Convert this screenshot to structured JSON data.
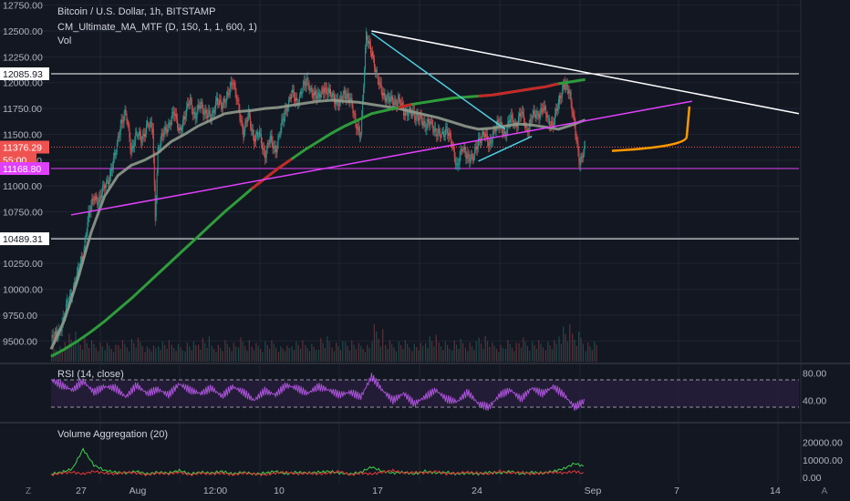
{
  "header": {
    "symbol": "Bitcoin / U.S. Dollar, 1h, BITSTAMP",
    "indicator": "CM_Ultimate_MA_MTF (D, 150, 1, 1, 600, 1)",
    "volume": "Vol"
  },
  "colors": {
    "background": "#131722",
    "up": "#26a69a",
    "down": "#ef5350",
    "trendline_white": "#ffffff",
    "trendline_magenta": "#e040fb",
    "trendline_cyan": "#4dd0e1",
    "ma_slow": "#2e9c3a",
    "ma_fast": "#8f9a8c",
    "projection": "#ff9800"
  },
  "chart_data": [
    {
      "type": "line",
      "title": "",
      "ylim": [
        9300,
        12800
      ],
      "y_ticks": [
        "12750.00",
        "12500.00",
        "12250.00",
        "12000.00",
        "11750.00",
        "11500.00",
        "11250.00",
        "11000.00",
        "10750.00",
        "10500.00",
        "10250.00",
        "10000.00",
        "9750.00",
        "9500.00"
      ],
      "x_ticks": [
        "27",
        "Aug",
        "12:00",
        "10",
        "17",
        "24",
        "Sep",
        "7",
        "14"
      ],
      "price_labels": [
        {
          "value": 12085.93,
          "text": "12085.93",
          "kind": "level"
        },
        {
          "value": 11376.29,
          "text": "11376.29",
          "kind": "last"
        },
        {
          "value": 11320,
          "text": "55:00",
          "kind": "countdown"
        },
        {
          "value": 11168.8,
          "text": "11168.80",
          "kind": "magenta"
        },
        {
          "value": 10489.31,
          "text": "10489.31",
          "kind": "level"
        }
      ],
      "horizontal_levels": [
        12085.93,
        10489.31,
        11168.8
      ],
      "last_price": 11376.29,
      "price_series": {
        "x": [
          0,
          3,
          6,
          9,
          12,
          16,
          20,
          24,
          28,
          32,
          36,
          40,
          44,
          48,
          52,
          56,
          60,
          64,
          68,
          72,
          76,
          78,
          80,
          84,
          88,
          92,
          96,
          100,
          104,
          108,
          112,
          116,
          120,
          124,
          128,
          132,
          136,
          140,
          144,
          148,
          152,
          156,
          160,
          164,
          168,
          172,
          176,
          180,
          184,
          188,
          192,
          196,
          200,
          204,
          208,
          212,
          216,
          220,
          224,
          228,
          232,
          236,
          240,
          244,
          248,
          252,
          256,
          260,
          264,
          268,
          272,
          276,
          280,
          284,
          288,
          292,
          296,
          300,
          304,
          308,
          312,
          316,
          320,
          324,
          328,
          332,
          336,
          340,
          344,
          348,
          352,
          356,
          360,
          364,
          368,
          372,
          376,
          380,
          384,
          388,
          392,
          396,
          400
        ],
        "y": [
          9500,
          9550,
          9600,
          9700,
          9850,
          10000,
          10150,
          10350,
          10700,
          10900,
          10850,
          11000,
          11100,
          11300,
          11600,
          11700,
          11350,
          11500,
          11450,
          11600,
          11550,
          10700,
          11350,
          11500,
          11600,
          11700,
          11550,
          11650,
          11850,
          11650,
          11800,
          11700,
          11650,
          11850,
          11750,
          11900,
          12000,
          11800,
          11500,
          11700,
          11450,
          11500,
          11300,
          11450,
          11350,
          11550,
          11750,
          11900,
          11800,
          11950,
          12000,
          11900,
          11850,
          11950,
          11900,
          11850,
          11800,
          11900,
          11850,
          11600,
          11500,
          12450,
          12300,
          12050,
          11900,
          11850,
          11800,
          11850,
          11700,
          11750,
          11650,
          11700,
          11550,
          11650,
          11500,
          11500,
          11550,
          11400,
          11200,
          11350,
          11300,
          11250,
          11450,
          11500,
          11400,
          11550,
          11600,
          11500,
          11650,
          11600,
          11700,
          11550,
          11650,
          11700,
          11750,
          11650,
          11600,
          11800,
          12000,
          11900,
          11600,
          11200,
          11376
        ]
      },
      "series": [
        {
          "x": [
            0,
            10,
            20,
            30,
            40,
            50,
            60,
            70,
            80,
            90,
            100,
            110,
            120,
            130,
            140,
            150,
            160,
            170,
            180,
            190,
            200,
            210,
            220,
            230,
            240,
            250,
            260,
            270,
            280,
            290,
            300,
            310,
            320,
            330,
            340,
            350,
            360,
            370,
            380,
            390,
            400
          ],
          "y": [
            9350,
            9420,
            9500,
            9590,
            9690,
            9800,
            9910,
            10030,
            10150,
            10270,
            10390,
            10510,
            10630,
            10750,
            10860,
            10970,
            11070,
            11170,
            11260,
            11350,
            11430,
            11510,
            11580,
            11640,
            11700,
            11730,
            11760,
            11790,
            11810,
            11830,
            11850,
            11860,
            11870,
            11880,
            11900,
            11920,
            11940,
            11960,
            11990,
            12010,
            12030
          ]
        },
        {
          "x": [
            0,
            10,
            20,
            30,
            40,
            50,
            60,
            70,
            80,
            90,
            100,
            110,
            120,
            130,
            140,
            150,
            160,
            170,
            180,
            190,
            200,
            210,
            220,
            230,
            240,
            250,
            260,
            270,
            280,
            290,
            300,
            310,
            320,
            330,
            340,
            350,
            360,
            370,
            380,
            390,
            400
          ],
          "y": [
            9420,
            9700,
            10100,
            10550,
            10900,
            11100,
            11200,
            11250,
            11320,
            11430,
            11500,
            11580,
            11640,
            11700,
            11720,
            11730,
            11750,
            11760,
            11780,
            11800,
            11820,
            11830,
            11820,
            11810,
            11790,
            11770,
            11750,
            11720,
            11690,
            11660,
            11620,
            11580,
            11550,
            11560,
            11580,
            11600,
            11590,
            11570,
            11550,
            11590,
            11640
          ]
        }
      ],
      "annotations": [
        {
          "kind": "trendline",
          "color": "#ffffff",
          "x": [
            240,
            560
          ],
          "y": [
            12500,
            11700
          ]
        },
        {
          "kind": "trendline",
          "color": "#e040fb",
          "x": [
            15,
            480
          ],
          "y": [
            10720,
            11820
          ]
        },
        {
          "kind": "trendline",
          "color": "#4dd0e1",
          "x": [
            240,
            340
          ],
          "y": [
            12480,
            11550
          ]
        },
        {
          "kind": "trendline",
          "color": "#4dd0e1",
          "x": [
            320,
            360
          ],
          "y": [
            11240,
            11480
          ]
        },
        {
          "kind": "projection",
          "color": "#ff9800",
          "x": [
            420,
            460,
            476,
            478
          ],
          "y": [
            11340,
            11380,
            11480,
            11770
          ]
        }
      ],
      "volume": {
        "x": [
          0,
          10,
          20,
          30,
          40,
          50,
          60,
          70,
          80,
          90,
          100,
          110,
          120,
          130,
          140,
          150,
          160,
          170,
          180,
          190,
          200,
          210,
          220,
          230,
          240,
          250,
          260,
          270,
          280,
          290,
          300,
          310,
          320,
          330,
          340,
          350,
          360,
          370,
          380,
          390,
          400
        ],
        "values": [
          0.2,
          0.5,
          0.4,
          0.3,
          0.25,
          0.3,
          0.35,
          0.2,
          0.3,
          0.25,
          0.3,
          0.4,
          0.25,
          0.3,
          0.35,
          0.25,
          0.3,
          0.2,
          0.3,
          0.25,
          0.4,
          0.3,
          0.35,
          0.25,
          0.6,
          0.3,
          0.3,
          0.25,
          0.4,
          0.3,
          0.35,
          0.3,
          0.45,
          0.25,
          0.3,
          0.35,
          0.3,
          0.3,
          0.6,
          0.5,
          0.3
        ]
      }
    },
    {
      "type": "line",
      "title": "RSI (14, close)",
      "ylim": [
        10,
        90
      ],
      "y_ticks": [
        "80.00",
        "40.00"
      ],
      "bands": [
        70,
        30
      ],
      "series": [
        {
          "x": [
            0,
            8,
            16,
            24,
            32,
            40,
            48,
            56,
            64,
            72,
            80,
            88,
            96,
            104,
            112,
            120,
            128,
            136,
            144,
            152,
            160,
            168,
            176,
            184,
            192,
            200,
            208,
            216,
            224,
            232,
            240,
            248,
            256,
            264,
            272,
            280,
            288,
            296,
            304,
            312,
            320,
            328,
            336,
            344,
            352,
            360,
            368,
            376,
            384,
            392,
            400
          ],
          "y": [
            70,
            62,
            55,
            68,
            52,
            60,
            58,
            45,
            62,
            50,
            56,
            48,
            64,
            55,
            50,
            58,
            46,
            60,
            52,
            40,
            54,
            48,
            62,
            58,
            50,
            60,
            55,
            48,
            52,
            45,
            75,
            55,
            40,
            50,
            35,
            45,
            55,
            42,
            38,
            52,
            35,
            30,
            48,
            55,
            42,
            58,
            50,
            60,
            48,
            30,
            40
          ]
        }
      ]
    },
    {
      "type": "line",
      "title": "Volume Aggregation (20)",
      "ylim": [
        -3000,
        30000
      ],
      "y_ticks": [
        "20000.00",
        "10000.00",
        "0.00"
      ],
      "series": [
        {
          "x": [
            0,
            8,
            16,
            24,
            32,
            40,
            48,
            56,
            64,
            72,
            80,
            88,
            96,
            104,
            112,
            120,
            128,
            136,
            144,
            152,
            160,
            168,
            176,
            184,
            192,
            200,
            208,
            216,
            224,
            232,
            240,
            248,
            256,
            264,
            272,
            280,
            288,
            296,
            304,
            312,
            320,
            328,
            336,
            344,
            352,
            360,
            368,
            376,
            384,
            392,
            400
          ],
          "y": [
            2000,
            3000,
            5000,
            16000,
            7000,
            4000,
            3000,
            2500,
            3500,
            2000,
            3000,
            2500,
            4000,
            2000,
            3000,
            2500,
            3500,
            2000,
            3000,
            2000,
            2500,
            3500,
            2000,
            3000,
            2500,
            3000,
            3500,
            2500,
            2000,
            3000,
            6000,
            3500,
            2500,
            3000,
            2000,
            3500,
            2500,
            3000,
            2000,
            2500,
            2000,
            3000,
            2500,
            3500,
            2000,
            3000,
            2500,
            3500,
            5000,
            8000,
            6000
          ]
        },
        {
          "x": [
            0,
            8,
            16,
            24,
            32,
            40,
            48,
            56,
            64,
            72,
            80,
            88,
            96,
            104,
            112,
            120,
            128,
            136,
            144,
            152,
            160,
            168,
            176,
            184,
            192,
            200,
            208,
            216,
            224,
            232,
            240,
            248,
            256,
            264,
            272,
            280,
            288,
            296,
            304,
            312,
            320,
            328,
            336,
            344,
            352,
            360,
            368,
            376,
            384,
            392,
            400
          ],
          "y": [
            1500,
            2500,
            3000,
            2000,
            3500,
            2500,
            2000,
            3000,
            2500,
            1500,
            2500,
            2000,
            3000,
            1500,
            2500,
            2000,
            2500,
            1500,
            2500,
            2000,
            1500,
            2500,
            3000,
            2000,
            2500,
            2000,
            2500,
            3500,
            1500,
            2500,
            2000,
            3000,
            4000,
            2500,
            3000,
            2500,
            3500,
            2000,
            2500,
            3000,
            2500,
            2000,
            3500,
            2500,
            3000,
            2000,
            2500,
            3000,
            2500,
            3500,
            2000
          ]
        }
      ]
    }
  ]
}
